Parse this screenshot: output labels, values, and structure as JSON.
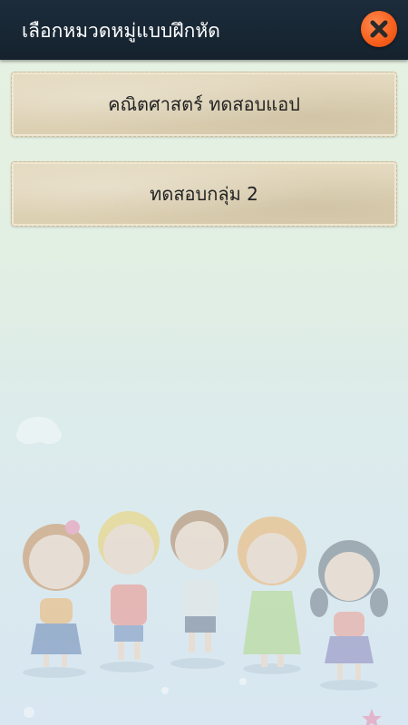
{
  "header": {
    "title": "เลือกหมวดหมู่แบบฝึกหัด",
    "close_icon": "close-x-icon",
    "close_color": "#f7611e"
  },
  "menu": {
    "items": [
      {
        "label": "คณิตศาสตร์ ทดสอบแอป"
      },
      {
        "label": "ทดสอบกลุ่ม 2"
      }
    ]
  },
  "background": {
    "illustration": "children-holding-hands",
    "gradient_top": "#e6f2e1",
    "gradient_bottom": "#d8e7f1"
  }
}
